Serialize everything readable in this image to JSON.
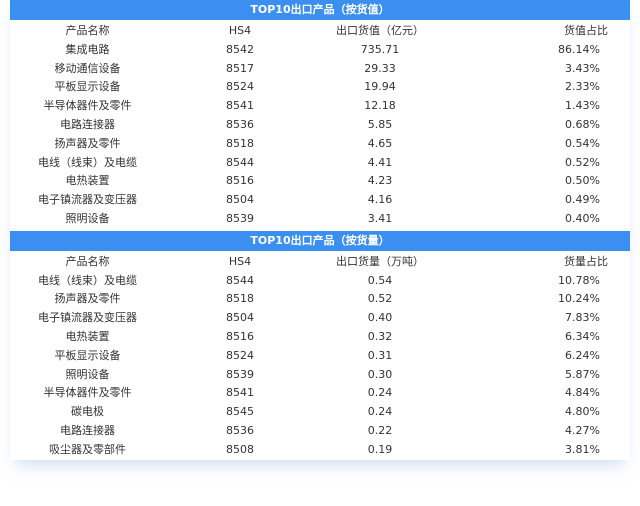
{
  "tables": [
    {
      "title": "TOP10出口产品（按货值）",
      "columns": [
        "产品名称",
        "HS4",
        "出口货值（亿元）",
        "货值占比"
      ],
      "rows": [
        [
          "集成电路",
          "8542",
          "735.71",
          "86.14%"
        ],
        [
          "移动通信设备",
          "8517",
          "29.33",
          "3.43%"
        ],
        [
          "平板显示设备",
          "8524",
          "19.94",
          "2.33%"
        ],
        [
          "半导体器件及零件",
          "8541",
          "12.18",
          "1.43%"
        ],
        [
          "电路连接器",
          "8536",
          "5.85",
          "0.68%"
        ],
        [
          "扬声器及零件",
          "8518",
          "4.65",
          "0.54%"
        ],
        [
          "电线（线束）及电缆",
          "8544",
          "4.41",
          "0.52%"
        ],
        [
          "电热装置",
          "8516",
          "4.23",
          "0.50%"
        ],
        [
          "电子镇流器及变压器",
          "8504",
          "4.16",
          "0.49%"
        ],
        [
          "照明设备",
          "8539",
          "3.41",
          "0.40%"
        ]
      ]
    },
    {
      "title": "TOP10出口产品（按货量）",
      "columns": [
        "产品名称",
        "HS4",
        "出口货量（万吨）",
        "货量占比"
      ],
      "rows": [
        [
          "电线（线束）及电缆",
          "8544",
          "0.54",
          "10.78%"
        ],
        [
          "扬声器及零件",
          "8518",
          "0.52",
          "10.24%"
        ],
        [
          "电子镇流器及变压器",
          "8504",
          "0.40",
          "7.83%"
        ],
        [
          "电热装置",
          "8516",
          "0.32",
          "6.34%"
        ],
        [
          "平板显示设备",
          "8524",
          "0.31",
          "6.24%"
        ],
        [
          "照明设备",
          "8539",
          "0.30",
          "5.87%"
        ],
        [
          "半导体器件及零件",
          "8541",
          "0.24",
          "4.84%"
        ],
        [
          "碳电极",
          "8545",
          "0.24",
          "4.80%"
        ],
        [
          "电路连接器",
          "8536",
          "0.22",
          "4.27%"
        ],
        [
          "吸尘器及零部件",
          "8508",
          "0.19",
          "3.81%"
        ]
      ]
    }
  ],
  "colors": {
    "header_bg": "#3a8ff0",
    "header_text": "#ffffff",
    "body_text": "#333333"
  }
}
